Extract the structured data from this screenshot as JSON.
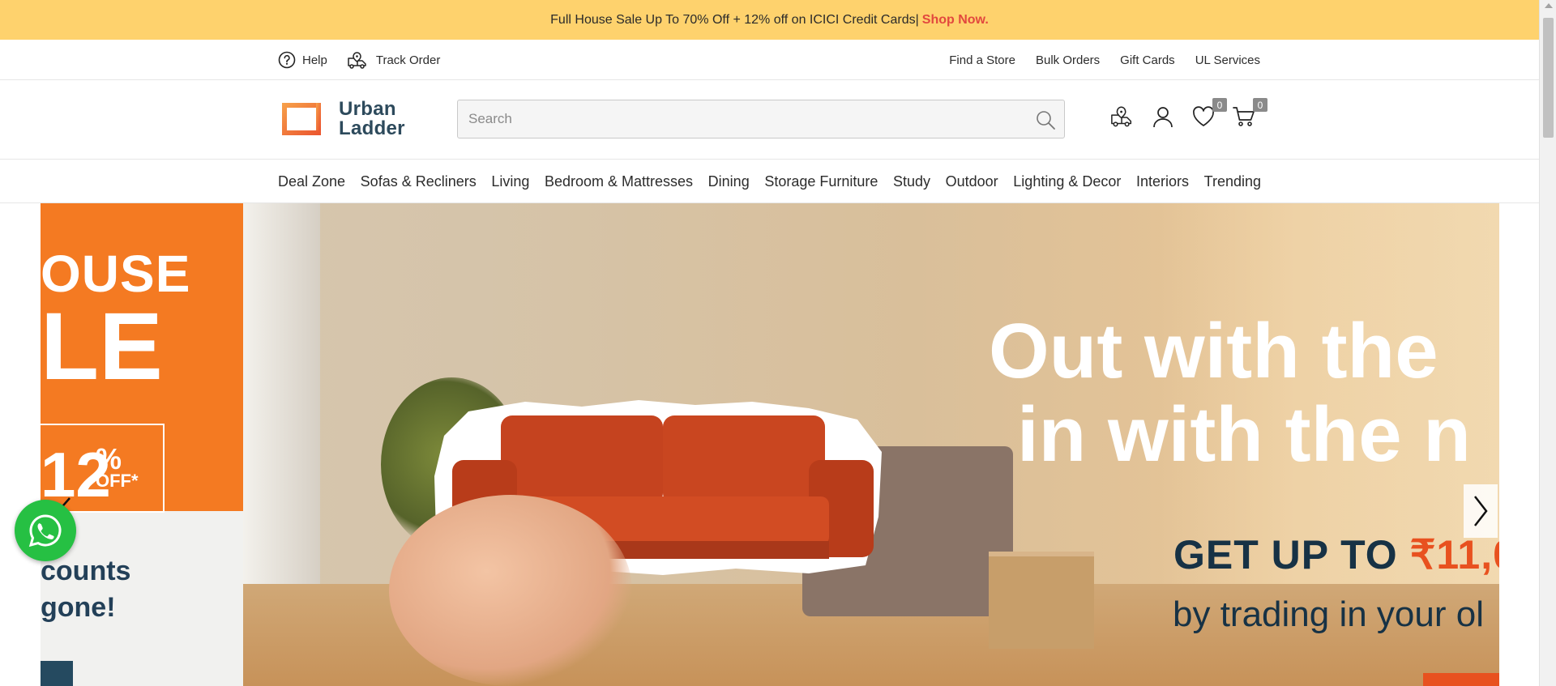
{
  "promo": {
    "text": "Full House Sale Up To 70% Off + 12% off on ICICI Credit Cards|",
    "link": "Shop Now."
  },
  "utility": {
    "help": "Help",
    "track_order": "Track Order",
    "find_store": "Find a Store",
    "bulk_orders": "Bulk Orders",
    "gift_cards": "Gift Cards",
    "ul_services": "UL Services"
  },
  "header": {
    "logo_line1": "Urban",
    "logo_line2": "Ladder",
    "search_placeholder": "Search",
    "wishlist_count": "0",
    "cart_count": "0"
  },
  "nav": {
    "items": [
      "Deal Zone",
      "Sofas & Recliners",
      "Living",
      "Bedroom & Mattresses",
      "Dining",
      "Storage Furniture",
      "Study",
      "Outdoor",
      "Lighting & Decor",
      "Interiors",
      "Trending"
    ]
  },
  "hero": {
    "side_ouse": "OUSE",
    "side_le": "LE",
    "side_12": "12",
    "side_pct": "%",
    "side_off": "OFF*",
    "side_disc1": "counts",
    "side_disc2": "gone!",
    "headline1": "Out with the",
    "headline2": "in with the n",
    "getup_prefix": "GET UP TO",
    "getup_amount": "₹11,0",
    "trade": "by trading in your ol"
  },
  "colors": {
    "promo_bg": "#fed26d",
    "promo_link": "#e2483e",
    "brand_orange": "#f47a22",
    "brand_navy": "#2d4a5c"
  }
}
